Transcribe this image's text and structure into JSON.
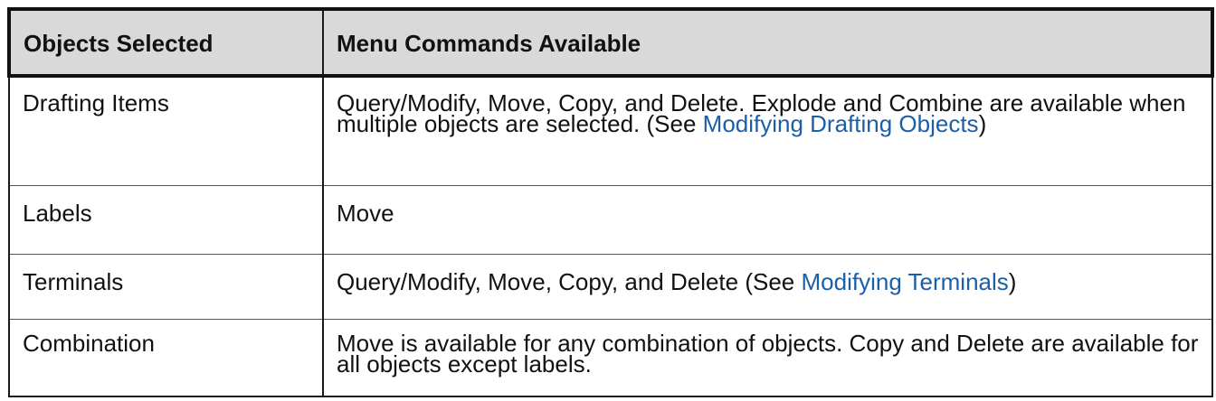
{
  "table": {
    "headers": {
      "objects": "Objects Selected",
      "commands": "Menu Commands Available"
    },
    "rows": [
      {
        "object": "Drafting Items",
        "text_before": "Query/Modify, Move, Copy, and Delete. Explode and Combine are available when multiple objects are selected. (See ",
        "link": "Modifying Drafting Objects",
        "text_after": ")"
      },
      {
        "object": "Labels",
        "text_before": "Move",
        "link": "",
        "text_after": ""
      },
      {
        "object": "Terminals",
        "text_before": "Query/Modify, Move, Copy, and Delete (See ",
        "link": "Modifying Terminals",
        "text_after": ")"
      },
      {
        "object": "Combination",
        "text_before": "Move is available for any combination of objects. Copy and Delete are available for all objects except labels.",
        "link": "",
        "text_after": ""
      }
    ]
  },
  "colors": {
    "header_background": "#d9d9d9",
    "link": "#1b5fa8",
    "border": "#111111"
  }
}
